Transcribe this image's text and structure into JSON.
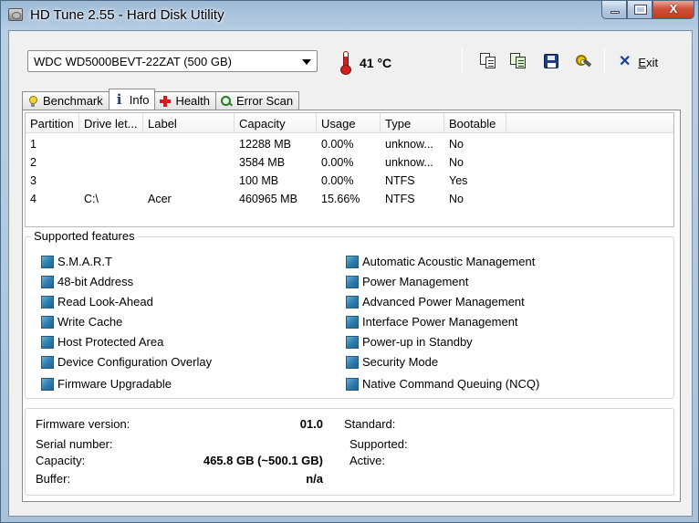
{
  "window": {
    "title": "HD Tune 2.55 - Hard Disk Utility",
    "controls": {
      "minimize": "minimize",
      "maximize": "maximize",
      "close": "X"
    }
  },
  "toolbar": {
    "drive": "WDC WD5000BEVT-22ZAT (500 GB)",
    "temperature": "41 °C",
    "exit_label_underlined": "E",
    "exit_label_rest": "xit",
    "icons": [
      "copy-text-icon",
      "copy-screenshot-icon",
      "save-icon",
      "options-icon",
      "exit-icon"
    ]
  },
  "tabs": [
    {
      "label": "Benchmark",
      "icon": "benchmark-icon",
      "active": false
    },
    {
      "label": "Info",
      "icon": "info-icon",
      "active": true
    },
    {
      "label": "Health",
      "icon": "health-icon",
      "active": false
    },
    {
      "label": "Error Scan",
      "icon": "error-scan-icon",
      "active": false
    }
  ],
  "partitions": {
    "columns": [
      "Partition",
      "Drive let...",
      "Label",
      "Capacity",
      "Usage",
      "Type",
      "Bootable"
    ],
    "rows": [
      [
        "1",
        "",
        "",
        "12288 MB",
        "0.00%",
        "unknow...",
        "No"
      ],
      [
        "2",
        "",
        "",
        "3584 MB",
        "0.00%",
        "unknow...",
        "No"
      ],
      [
        "3",
        "",
        "",
        "100 MB",
        "0.00%",
        "NTFS",
        "Yes"
      ],
      [
        "4",
        "C:\\",
        "Acer",
        "460965 MB",
        "15.66%",
        "NTFS",
        "No"
      ]
    ]
  },
  "features": {
    "title": "Supported features",
    "left": [
      "S.M.A.R.T",
      "48-bit Address",
      "Read Look-Ahead",
      "Write Cache",
      "Host Protected Area",
      "Device Configuration Overlay",
      "Firmware Upgradable"
    ],
    "right": [
      "Automatic Acoustic Management",
      "Power Management",
      "Advanced Power Management",
      "Interface Power Management",
      "Power-up in Standby",
      "Security Mode",
      "Native Command Queuing (NCQ)"
    ]
  },
  "info": {
    "firmware_label": "Firmware version:",
    "firmware_value": "01.0",
    "serial_label": "Serial number:",
    "serial_value": "",
    "capacity_label": "Capacity:",
    "capacity_value": "465.8 GB (~500.1 GB)",
    "buffer_label": "Buffer:",
    "buffer_value": "n/a",
    "standard_label": "Standard:",
    "standard_value": "",
    "supported_label": "Supported:",
    "supported_value": "",
    "active_label": "Active:",
    "active_value": ""
  }
}
